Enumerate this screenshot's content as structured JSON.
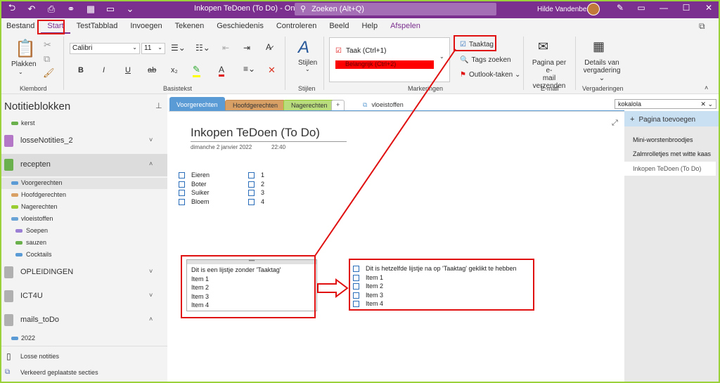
{
  "titlebar": {
    "doc_title": "Inkopen TeDoen (To Do)  -  OneNote",
    "search_placeholder": "Zoeken (Alt+Q)",
    "username": "Hilde Vandenberk"
  },
  "menu": [
    "Bestand",
    "Start",
    "TestTabblad",
    "Invoegen",
    "Tekenen",
    "Geschiedenis",
    "Controleren",
    "Beeld",
    "Help",
    "Afspelen"
  ],
  "ribbon": {
    "klembord": {
      "paste": "Plakken",
      "label": "Klembord"
    },
    "basistekst": {
      "font": "Calibri",
      "size": "11",
      "label": "Basistekst",
      "bold": "B",
      "italic": "I",
      "underline": "U",
      "strike": "ab",
      "sub": "x₂",
      "font_color": "A",
      "clear": "✕"
    },
    "stijlen": {
      "button": "Stijlen",
      "label": "Stijlen"
    },
    "markeringen": {
      "tag1": "Taak (Ctrl+1)",
      "tag2": "Belangrijk (Ctrl+2)",
      "taaktag": "Taaktag",
      "tags_zoeken": "Tags zoeken",
      "outlook": "Outlook-taken",
      "label": "Markeringen"
    },
    "email": {
      "button_line1": "Pagina per e-",
      "button_line2": "mail verzenden",
      "label": "E-mail"
    },
    "vergaderingen": {
      "button_line1": "Details van",
      "button_line2": "vergadering",
      "label": "Vergaderingen"
    }
  },
  "notebooks": {
    "title": "Notitieblokken",
    "items": [
      {
        "type": "sec",
        "name": "kerst",
        "color": "#6ab04c"
      },
      {
        "type": "book",
        "name": "losseNotities_2",
        "color": "#b476c6",
        "chev": "˅"
      },
      {
        "type": "book",
        "name": "recepten",
        "color": "#6ab04c",
        "chev": "˄",
        "selected": true
      },
      {
        "type": "sec",
        "name": "Voorgerechten",
        "color": "#5b9bd5",
        "selected": true
      },
      {
        "type": "sec",
        "name": "Hoofdgerechten",
        "color": "#d9a066"
      },
      {
        "type": "sec",
        "name": "Nagerechten",
        "color": "#9acd32"
      },
      {
        "type": "sec",
        "name": "vloeistoffen",
        "color": "#6aa3d6",
        "group": true
      },
      {
        "type": "sub",
        "name": "Soepen",
        "color": "#9b7fd4"
      },
      {
        "type": "sub",
        "name": "sauzen",
        "color": "#6ab04c"
      },
      {
        "type": "sub",
        "name": "Cocktails",
        "color": "#5b9bd5"
      },
      {
        "type": "book",
        "name": "OPLEIDINGEN",
        "color": "#b0b0b0",
        "chev": "˅"
      },
      {
        "type": "book",
        "name": "ICT4U",
        "color": "#b0b0b0",
        "chev": "˅"
      },
      {
        "type": "book",
        "name": "mails_toDo",
        "color": "#b0b0b0",
        "chev": "˄"
      },
      {
        "type": "sec",
        "name": "2022",
        "color": "#5b9bd5"
      }
    ],
    "losse": "Losse notities",
    "verkeerd": "Verkeerd geplaatste secties"
  },
  "section_tabs": [
    "Voorgerechten",
    "Hoofdgerechten",
    "Nagerechten",
    "+",
    "vloeistoffen"
  ],
  "page": {
    "title": "Inkopen TeDoen (To Do)",
    "date": "dimanche 2 janvier 2022",
    "time": "22:40",
    "list_a": [
      "Eieren",
      "Boter",
      "Suiker",
      "Bloem"
    ],
    "list_b": [
      "1",
      "2",
      "3",
      "4"
    ],
    "note_before": [
      "Dit is een lijstje zonder 'Taaktag'",
      "Item 1",
      "Item 2",
      "Item 3",
      "Item 4"
    ],
    "note_after": [
      "Dit is hetzelfde lijstje na op 'Taaktag' geklikt te hebben",
      "Item 1",
      "Item 2",
      "Item 3",
      "Item 4"
    ]
  },
  "right": {
    "search_value": "kokalola",
    "add_page": "Pagina toevoegen",
    "pages": [
      "Mini-worstenbroodjes",
      "Zalmrolletjes met witte kaas",
      "Inkopen TeDoen (To Do)"
    ]
  },
  "colors": {
    "accent": "#7b2f8f",
    "annotation": "#e01010",
    "frame": "#9bd13a"
  }
}
